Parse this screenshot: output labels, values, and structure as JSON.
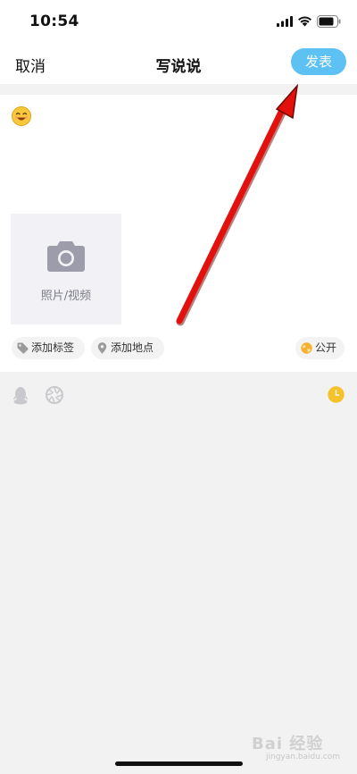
{
  "status_bar": {
    "time": "10:54",
    "icons": [
      "signal-icon",
      "wifi-icon",
      "battery-icon"
    ]
  },
  "nav": {
    "cancel_label": "取消",
    "title": "写说说",
    "publish_label": "发表"
  },
  "compose": {
    "emoji_icon": "smiley-emoji-icon",
    "media_label": "照片/视频",
    "tag_chip_label": "添加标签",
    "location_chip_label": "添加地点",
    "visibility_label": "公开"
  },
  "tools": {
    "icons": [
      "qq-penguin-icon",
      "shutter-icon",
      "clock-icon"
    ]
  },
  "watermark": {
    "text": "Bai 经验",
    "sub": "jingyan.baidu.com"
  },
  "colors": {
    "publish_button": "#5ec1f4",
    "annotation_arrow": "#e2110d",
    "clock_icon": "#f5c22c",
    "media_box_bg": "#f1f1f6",
    "page_bg": "#f2f2f2"
  }
}
